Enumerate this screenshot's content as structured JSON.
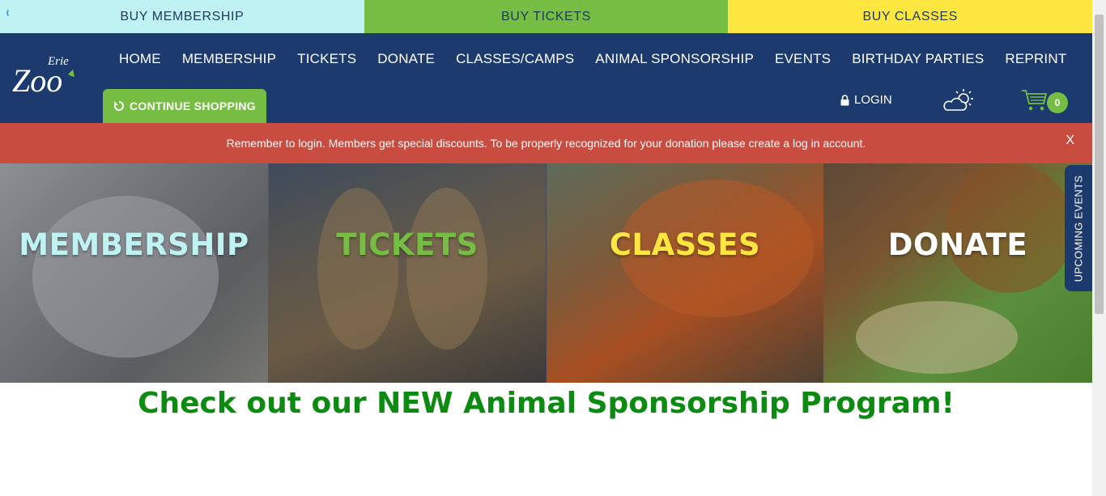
{
  "topbar": {
    "buy_membership": "BUY MEMBERSHIP",
    "buy_tickets": "BUY TICKETS",
    "buy_classes": "BUY CLASSES"
  },
  "logo": {
    "top_text": "Erie",
    "main_text": "Zoo"
  },
  "nav": {
    "items": [
      "HOME",
      "MEMBERSHIP",
      "TICKETS",
      "DONATE",
      "CLASSES/CAMPS",
      "ANIMAL SPONSORSHIP",
      "EVENTS",
      "BIRTHDAY PARTIES",
      "REPRINT"
    ]
  },
  "header": {
    "continue_label": "CONTINUE SHOPPING",
    "login_label": "LOGIN",
    "cart_count": "0"
  },
  "alert": {
    "message": "Remember to login. Members get special discounts. To be properly recognized for your donation please create a log in account.",
    "close_label": "X"
  },
  "tiles": [
    {
      "label": "MEMBERSHIP",
      "color": "#bff2f2"
    },
    {
      "label": "TICKETS",
      "color": "#76bd43"
    },
    {
      "label": "CLASSES",
      "color": "#fde63f"
    },
    {
      "label": "DONATE",
      "color": "#ffffff"
    }
  ],
  "upcoming_events_label": "UPCOMING EVENTS",
  "promo": {
    "headline": "Check out our NEW Animal Sponsorship Program!"
  },
  "colors": {
    "navy": "#1c3a6e",
    "green": "#76bd43",
    "cyan": "#bff2f2",
    "yellow": "#fde63f",
    "alert_red": "#c94c41",
    "promo_green": "#0d8a11"
  }
}
